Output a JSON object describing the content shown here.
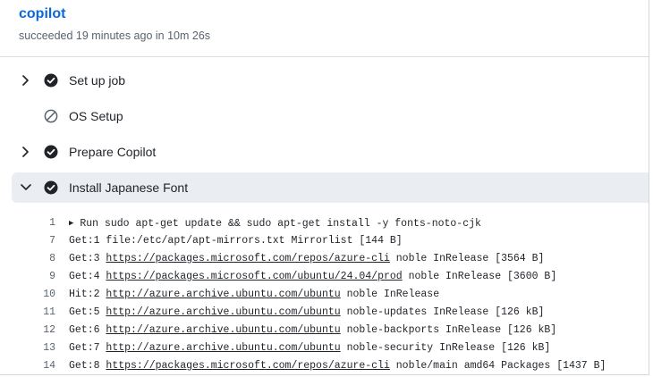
{
  "job": {
    "title": "copilot",
    "status": "succeeded 19 minutes ago in 10m 26s"
  },
  "steps": [
    {
      "label": "Set up job",
      "status": "success",
      "expanded": false
    },
    {
      "label": "OS Setup",
      "status": "skipped",
      "expanded": false
    },
    {
      "label": "Prepare Copilot",
      "status": "success",
      "expanded": false
    },
    {
      "label": "Install Japanese Font",
      "status": "success",
      "expanded": true
    }
  ],
  "log": [
    {
      "n": "1",
      "group": true,
      "text": "Run sudo apt-get update && sudo apt-get install -y fonts-noto-cjk"
    },
    {
      "n": "7",
      "pre": "Get:1 ",
      "link": "",
      "post": "file:/etc/apt/apt-mirrors.txt Mirrorlist [144 B]"
    },
    {
      "n": "8",
      "pre": "Get:3 ",
      "link": "https://packages.microsoft.com/repos/azure-cli",
      "post": " noble InRelease [3564 B]"
    },
    {
      "n": "9",
      "pre": "Get:4 ",
      "link": "https://packages.microsoft.com/ubuntu/24.04/prod",
      "post": " noble InRelease [3600 B]"
    },
    {
      "n": "10",
      "pre": "Hit:2 ",
      "link": "http://azure.archive.ubuntu.com/ubuntu",
      "post": " noble InRelease"
    },
    {
      "n": "11",
      "pre": "Get:5 ",
      "link": "http://azure.archive.ubuntu.com/ubuntu",
      "post": " noble-updates InRelease [126 kB]"
    },
    {
      "n": "12",
      "pre": "Get:6 ",
      "link": "http://azure.archive.ubuntu.com/ubuntu",
      "post": " noble-backports InRelease [126 kB]"
    },
    {
      "n": "13",
      "pre": "Get:7 ",
      "link": "http://azure.archive.ubuntu.com/ubuntu",
      "post": " noble-security InRelease [126 kB]"
    },
    {
      "n": "14",
      "pre": "Get:8 ",
      "link": "https://packages.microsoft.com/repos/azure-cli",
      "post": " noble/main amd64 Packages [1437 B]"
    }
  ],
  "colors": {
    "link": "#0969da",
    "icon": "#59636e",
    "expanded_bg": "#eaeef2"
  },
  "icons": {
    "collapsed": "chevron-right-icon",
    "expanded": "chevron-down-icon",
    "success": "check-circle-fill-icon",
    "skipped": "skip-icon",
    "group": "triangle-right-icon"
  }
}
